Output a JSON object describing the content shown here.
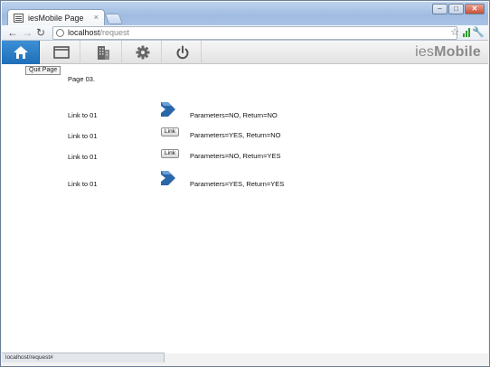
{
  "browser": {
    "tab_title": "iesMobile Page",
    "tab_close": "×",
    "url_host": "localhost",
    "url_path": "/request",
    "status_url": "localhost/request#",
    "window_buttons": {
      "minimize": "–",
      "maximize": "□",
      "close": "✕"
    }
  },
  "app": {
    "brand_light": "ies",
    "brand_bold": "Mobile",
    "tooltip": "Quit Page",
    "nav_icons": [
      "home-icon",
      "window-icon",
      "building-icon",
      "gear-icon",
      "power-icon"
    ],
    "accent": "#2a7cc7"
  },
  "page": {
    "heading": "Page 03.",
    "rows": [
      {
        "link": "Link to 01",
        "control": "arrow",
        "params": "Parameters=NO, Return=NO"
      },
      {
        "link": "Link to 01",
        "control": "button",
        "button_label": "Link",
        "params": "Parameters=YES, Return=NO"
      },
      {
        "link": "Link to 01",
        "control": "button",
        "button_label": "Link",
        "params": "Parameters=NO, Return=YES"
      },
      {
        "link": "Link to 01",
        "control": "arrow",
        "params": "Parameters=YES, Return=YES"
      }
    ]
  }
}
